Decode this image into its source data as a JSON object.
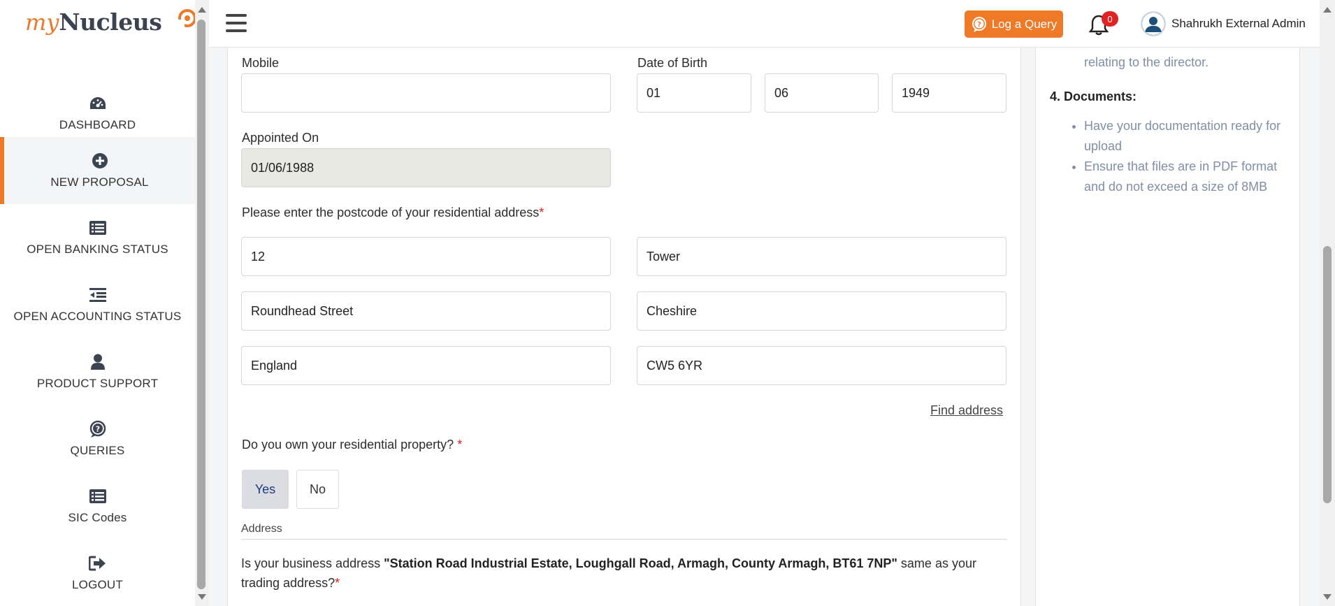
{
  "brand": {
    "logo_my": "my",
    "logo_nucleus": "Nucleus",
    "accent": "#ee7a28"
  },
  "sidebar": {
    "items": [
      {
        "label": "DASHBOARD",
        "icon": "dashboard-gauge-icon"
      },
      {
        "label": "NEW PROPOSAL",
        "icon": "plus-circle-icon",
        "active": true
      },
      {
        "label": "OPEN BANKING STATUS",
        "icon": "list-card-icon"
      },
      {
        "label": "OPEN ACCOUNTING STATUS",
        "icon": "indent-list-icon"
      },
      {
        "label": "PRODUCT SUPPORT",
        "icon": "user-icon"
      },
      {
        "label": "QUERIES",
        "icon": "question-circle-icon"
      },
      {
        "label": "SIC Codes",
        "icon": "list-card-icon"
      },
      {
        "label": "LOGOUT",
        "icon": "sign-out-icon"
      }
    ]
  },
  "header": {
    "log_query": "Log a Query",
    "notifications_count": "0",
    "user_name": "Shahrukh External Admin"
  },
  "form": {
    "mobile_label": "Mobile",
    "mobile_value": "",
    "dob_label": "Date of Birth",
    "dob_day": "01",
    "dob_month": "06",
    "dob_year": "1949",
    "appointed_label": "Appointed On",
    "appointed_value": "01/06/1988",
    "postcode_prompt": "Please enter the postcode of your residential address",
    "required_mark": "*",
    "address": {
      "line1": "12",
      "line2": "Tower",
      "street": "Roundhead Street",
      "county": "Cheshire",
      "country": "England",
      "postcode": "CW5 6YR"
    },
    "find_address": "Find address",
    "own_property_question": "Do you own your residential property?",
    "yes": "Yes",
    "no": "No",
    "address_section": "Address",
    "business_q_pre": "Is your business address ",
    "business_address": "\"Station Road Industrial Estate, Loughgall Road, Armagh, County Armagh, BT61 7NP\"",
    "business_q_post": " same as your trading address?"
  },
  "guidance": {
    "prev_line": "relating to the director.",
    "documents_heading": "4. Documents:",
    "documents_items": [
      "Have your documentation ready for upload",
      "Ensure that files are in PDF format and do not exceed a size of 8MB"
    ]
  }
}
